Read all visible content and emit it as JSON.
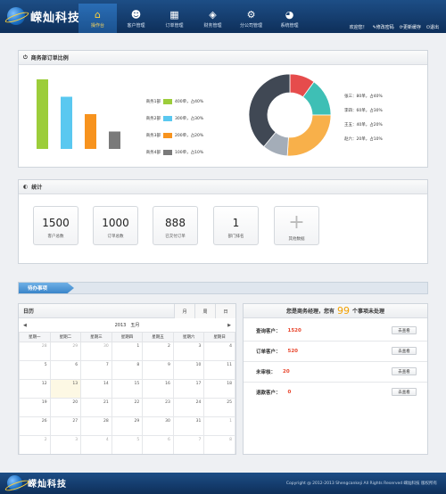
{
  "app": {
    "brand": "嵘灿科技"
  },
  "nav": [
    {
      "label": "操作台",
      "icon": "home-icon",
      "active": true
    },
    {
      "label": "客户管理",
      "icon": "user-icon"
    },
    {
      "label": "订单管理",
      "icon": "grid-icon"
    },
    {
      "label": "财务管理",
      "icon": "tag-icon"
    },
    {
      "label": "分公司管理",
      "icon": "gears-icon"
    },
    {
      "label": "系统管理",
      "icon": "pie-icon"
    }
  ],
  "userbar": {
    "greeting": "欢迎您！",
    "change_password": "修改密码",
    "refresh_cache": "更新缓存",
    "logout": "退出"
  },
  "chart_panel": {
    "title": "商务部订单比例",
    "bar_legend": [
      {
        "name": "商务1部",
        "text": "400单，占40%",
        "color": "#9ccd3a"
      },
      {
        "name": "商务2部",
        "text": "300单，占30%",
        "color": "#5ac8f0"
      },
      {
        "name": "商务3部",
        "text": "200单，占20%",
        "color": "#f7931e"
      },
      {
        "name": "商务4部",
        "text": "100单，占10%",
        "color": "#7a7a7a"
      }
    ],
    "donut_legend": [
      "张三：80单，占40%",
      "李四：60单，占30%",
      "王五：40单，占20%",
      "赵六：20单，占10%"
    ]
  },
  "chart_data": [
    {
      "type": "bar",
      "categories": [
        "商务1部",
        "商务2部",
        "商务3部",
        "商务4部"
      ],
      "values": [
        400,
        300,
        200,
        100
      ],
      "colors": [
        "#9ccd3a",
        "#5ac8f0",
        "#f7931e",
        "#7a7a7a"
      ],
      "ylim": [
        0,
        400
      ]
    },
    {
      "type": "pie",
      "categories": [
        "",
        "",
        "",
        "",
        ""
      ],
      "values": [
        10,
        15,
        26,
        10,
        39
      ],
      "colors": [
        "#e64c4c",
        "#3ebfb5",
        "#f8b04a",
        "#a4adb8",
        "#404854"
      ]
    }
  ],
  "stats_panel": {
    "title": "统计",
    "items": [
      {
        "value": "1500",
        "label": "客户总数"
      },
      {
        "value": "1000",
        "label": "订单总数"
      },
      {
        "value": "888",
        "label": "已交付订单"
      },
      {
        "value": "1",
        "label": "部门排名"
      }
    ],
    "more_label": "其他数据"
  },
  "todo": {
    "title": "待办事项"
  },
  "calendar": {
    "title": "日历",
    "tabs": [
      "月",
      "周",
      "日"
    ],
    "month_label": "2013　五月",
    "weekdays": [
      "星期一",
      "星期二",
      "星期三",
      "星期四",
      "星期五",
      "星期六",
      "星期日"
    ],
    "weeks": [
      [
        "28",
        "29",
        "30",
        "1",
        "2",
        "3",
        "4"
      ],
      [
        "5",
        "6",
        "7",
        "8",
        "9",
        "10",
        "11"
      ],
      [
        "12",
        "13",
        "14",
        "15",
        "16",
        "17",
        "18"
      ],
      [
        "19",
        "20",
        "21",
        "22",
        "23",
        "24",
        "25"
      ],
      [
        "26",
        "27",
        "28",
        "29",
        "30",
        "31",
        "1"
      ],
      [
        "2",
        "3",
        "4",
        "5",
        "6",
        "7",
        "8"
      ]
    ]
  },
  "process": {
    "prefix": "您是商务经理，您有",
    "count": "99",
    "suffix": "个事项未处理",
    "rows": [
      {
        "label": "查询客户：",
        "value": "1520",
        "button": "去查看"
      },
      {
        "label": "订单客户：",
        "value": "520",
        "button": "去查看"
      },
      {
        "label": "未审核：",
        "value": "20",
        "button": "去查看"
      },
      {
        "label": "退款客户：",
        "value": "0",
        "button": "去查看"
      }
    ]
  },
  "footer": {
    "brand": "嵘灿科技",
    "copyright": "Copyright @ 2012-2013 Shengcankeji All Rights Reserved 嵘灿科技 版权所有"
  }
}
